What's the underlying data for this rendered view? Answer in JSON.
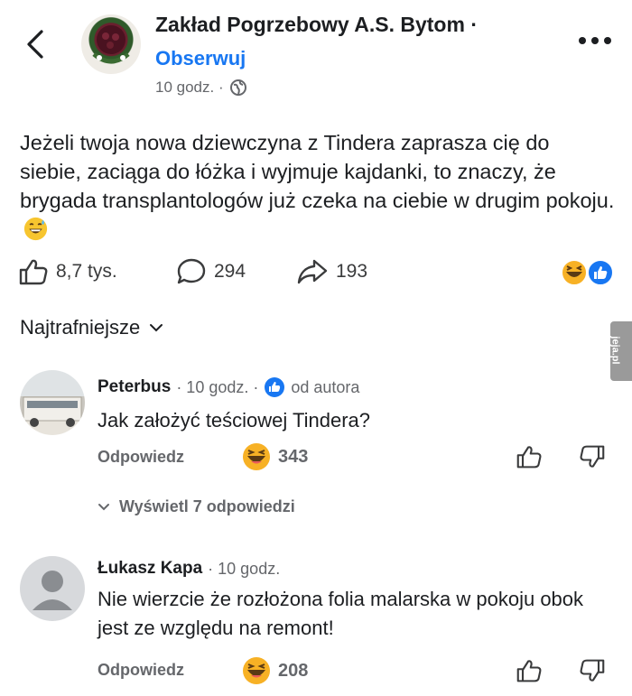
{
  "header": {
    "page_name": "Zakład Pogrzebowy A.S. Bytom ·",
    "follow_label": "Obserwuj",
    "time": "10 godz. ·"
  },
  "post": {
    "text": "Jeżeli twoja nowa dziewczyna z Tindera zaprasza cię do siebie, zaciąga do łóżka i wyjmuje kajdanki, to znaczy, że brygada transplantologów już czeka na ciebie w drugim pokoju.",
    "likes": "8,7 tys.",
    "comments": "294",
    "shares": "193"
  },
  "sort": {
    "label": "Najtrafniejsze"
  },
  "watermark": "jeja.pl",
  "comments": [
    {
      "author": "Peterbus",
      "time": "· 10 godz. ·",
      "badge": "od autora",
      "text": "Jak założyć teściowej Tindera?",
      "reply_label": "Odpowiedz",
      "reaction_count": "343",
      "view_replies": "Wyświetl 7 odpowiedzi"
    },
    {
      "author": "Łukasz Kapa",
      "time": "· 10 godz.",
      "text": "Nie wierzcie że rozłożona folia malarska w pokoju obok jest ze względu na remont!",
      "reply_label": "Odpowiedz",
      "reaction_count": "208"
    }
  ],
  "colors": {
    "accent": "#1877f2",
    "secondary_text": "#65676b",
    "primary_text": "#1c1e21",
    "haha": "#f7b125"
  },
  "icons": [
    "back-icon",
    "more-icon",
    "globe-icon",
    "like-icon",
    "comment-icon",
    "share-icon",
    "haha-icon",
    "chevron-down-icon",
    "dislike-icon"
  ]
}
